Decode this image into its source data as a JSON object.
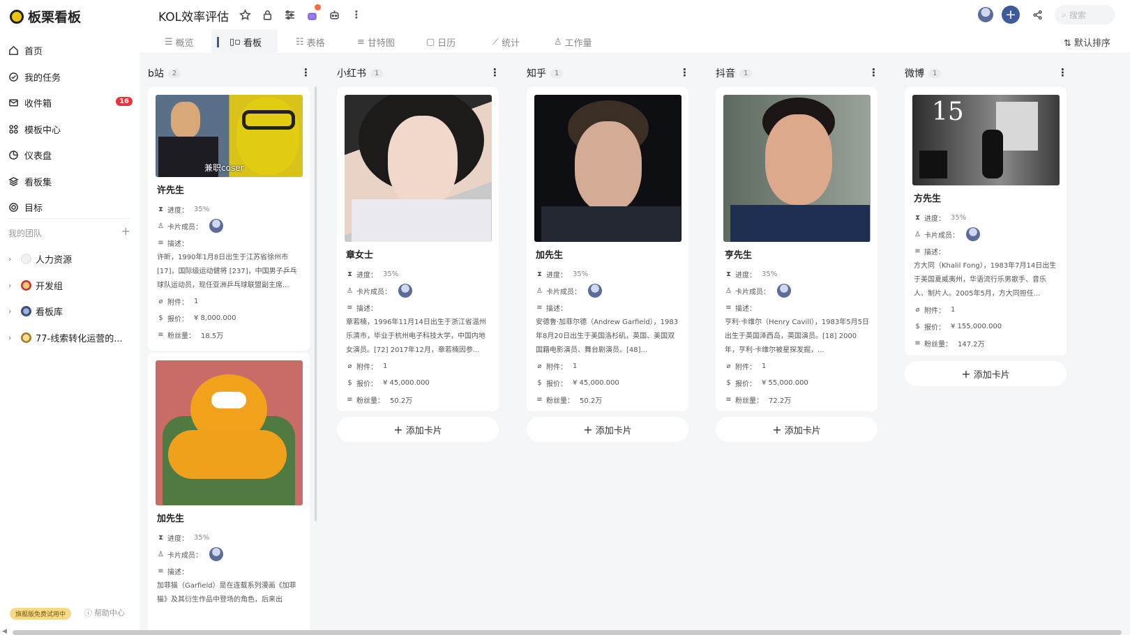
{
  "app": {
    "name": "板栗看板"
  },
  "nav": [
    {
      "label": "首页",
      "icon": "home-icon"
    },
    {
      "label": "我的任务",
      "icon": "check-circle-icon"
    },
    {
      "label": "收件箱",
      "icon": "mail-icon",
      "badge": "16"
    },
    {
      "label": "模板中心",
      "icon": "template-icon"
    },
    {
      "label": "仪表盘",
      "icon": "dashboard-icon"
    },
    {
      "label": "看板集",
      "icon": "layers-icon"
    },
    {
      "label": "目标",
      "icon": "target-icon"
    }
  ],
  "teams": {
    "title": "我的团队",
    "items": [
      "人力资源",
      "开发组",
      "看板库",
      "77-线索转化运营的..."
    ]
  },
  "footer": {
    "trial": "旗舰版免费试用中",
    "help": "帮助中心"
  },
  "header": {
    "title": "KOL效率评估",
    "search_placeholder": "搜索"
  },
  "tabs": [
    {
      "label": "概览"
    },
    {
      "label": "看板"
    },
    {
      "label": "表格"
    },
    {
      "label": "甘特图"
    },
    {
      "label": "日历"
    },
    {
      "label": "统计"
    },
    {
      "label": "工作量"
    }
  ],
  "sort_label": "默认排序",
  "field_labels": {
    "progress": "进度：",
    "members": "卡片成员：",
    "desc": "描述：",
    "attach": "附件：",
    "price": "报价：",
    "fans": "粉丝量："
  },
  "add_card": "添加卡片",
  "columns": [
    {
      "name": "b站",
      "count": "2",
      "cards": [
        {
          "name": "许先生",
          "progress": "35%",
          "desc": "许昕，1990年1月8日出生于江苏省徐州市[17]，国际级运动健将 [237]，中国男子乒乓球队运动员，现任亚洲乒乓球联盟副主席...",
          "attach": "1",
          "price": "¥ 8,000.000",
          "fans": "18.5万",
          "overlay": "兼职coser"
        },
        {
          "name": "加先生",
          "progress": "35%",
          "desc": "加菲猫（Garfield）是在连载系列漫画《加菲猫》及其衍生作品中登场的角色，后来出"
        }
      ]
    },
    {
      "name": "小红书",
      "count": "1",
      "cards": [
        {
          "name": "章女士",
          "progress": "35%",
          "desc": "章若楠，1996年11月14日出生于浙江省温州乐清市，毕业于杭州电子科技大学，中国内地女演员。[72] 2017年12月，章若楠因参...",
          "attach": "1",
          "price": "¥ 45,000.000",
          "fans": "50.2万"
        }
      ]
    },
    {
      "name": "知乎",
      "count": "1",
      "cards": [
        {
          "name": "加先生",
          "progress": "35%",
          "desc": "安德鲁·加菲尔德（Andrew Garfield），1983年8月20日出生于美国洛杉矶，英国、美国双国籍电影演员、舞台剧演员。[48]...",
          "attach": "1",
          "price": "¥ 45,000.000",
          "fans": "50.2万"
        }
      ]
    },
    {
      "name": "抖音",
      "count": "1",
      "cards": [
        {
          "name": "亨先生",
          "progress": "35%",
          "desc": "亨利·卡维尔（Henry Cavill），1983年5月5日出生于英国泽西岛，英国演员。[18] 2000年，亨利·卡维尔被星探发掘，...",
          "attach": "1",
          "price": "¥ 55,000.000",
          "fans": "72.2万"
        }
      ]
    },
    {
      "name": "微博",
      "count": "1",
      "cards": [
        {
          "name": "方先生",
          "progress": "35%",
          "desc": "方大同（Khalil Fong），1983年7月14日出生于美国夏威夷州，华语流行乐男歌手、音乐人、制片人。2005年5月，方大同担任...",
          "attach": "1",
          "price": "¥ 155,000.000",
          "fans": "147.2万",
          "poster_text": "15"
        }
      ]
    }
  ]
}
